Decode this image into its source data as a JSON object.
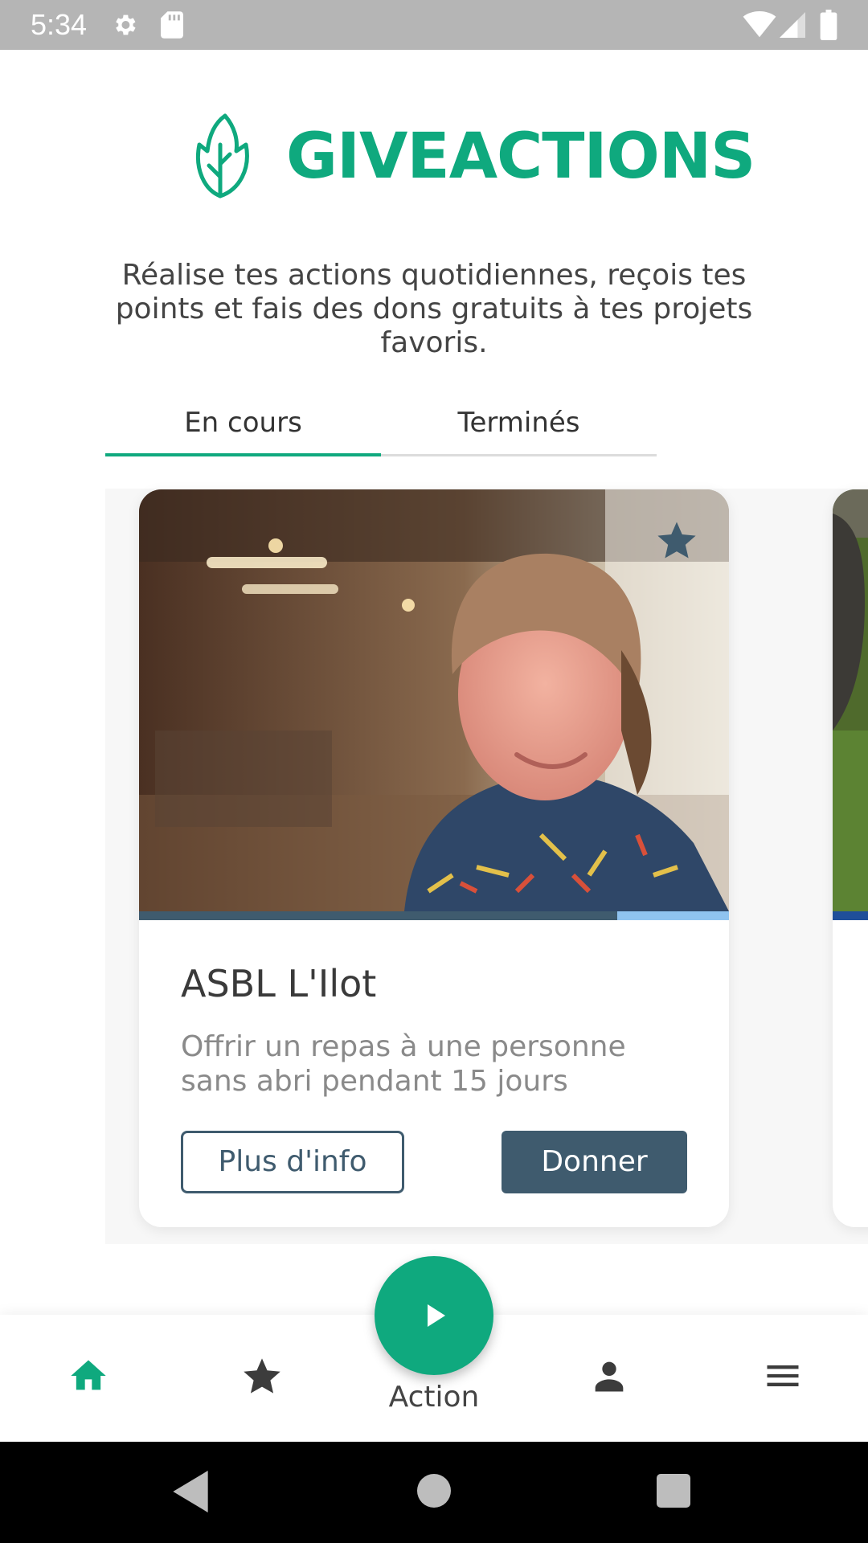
{
  "status_bar": {
    "time": "5:34",
    "icons": [
      "gear-icon",
      "sd-card-icon",
      "wifi-icon",
      "signal-icon",
      "battery-icon"
    ]
  },
  "header": {
    "brand": "GIVEACTIONS",
    "brand_color": "#0fa97e",
    "intro": "Réalise tes actions quotidiennes, reçois tes points et fais des dons gratuits à tes projets favoris."
  },
  "tabs": [
    {
      "label": "En cours",
      "active": true
    },
    {
      "label": "Terminés",
      "active": false
    }
  ],
  "cards": [
    {
      "title": "ASBL L'Ilot",
      "description": "Offrir un repas à une personne sans abri pendant 15 jours",
      "progress": 0.81,
      "favorite": true,
      "info_button": "Plus d'info",
      "give_button": "Donner"
    }
  ],
  "bottom_nav": {
    "items": [
      "home-icon",
      "star-icon",
      "play-icon",
      "person-icon",
      "menu-icon"
    ],
    "action_label": "Action",
    "active_color": "#0fa97e"
  },
  "colors": {
    "accent": "#0fa97e",
    "primary_dark": "#3f5b6e"
  }
}
